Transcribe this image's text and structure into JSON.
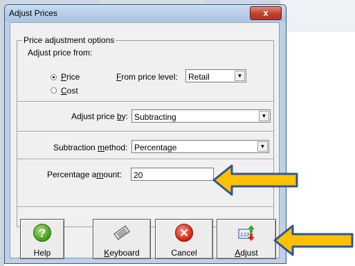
{
  "background": {
    "app_strip_color": "#cfd8e3"
  },
  "dialog": {
    "title": "Adjust Prices",
    "close_symbol": "x",
    "group_title": "Price adjustment options",
    "adjust_from_label": "Adjust price from:",
    "options": {
      "price": {
        "label": "Price",
        "checked": true
      },
      "cost": {
        "label": "Cost",
        "checked": false
      }
    },
    "from_price_level": {
      "label": "From price level:",
      "value": "Retail"
    },
    "adjust_by": {
      "label": "Adjust price by:",
      "value": "Subtracting"
    },
    "subtraction_method": {
      "label": "Subtraction method:",
      "value": "Percentage"
    },
    "percentage_amount": {
      "label": "Percentage amount:",
      "value": "20"
    },
    "buttons": {
      "help": "Help",
      "keyboard": "Keyboard",
      "cancel": "Cancel",
      "adjust": "Adjust"
    }
  },
  "annotations": {
    "arrow_fill": "#ffc000",
    "arrow_stroke": "#2f5496"
  }
}
